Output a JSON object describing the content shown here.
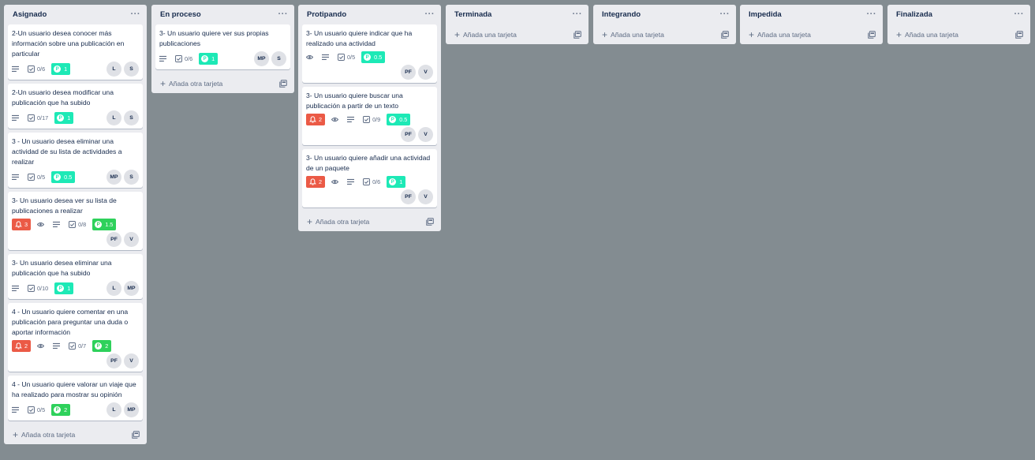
{
  "colors": {
    "board_bg": "#838c91",
    "points_light": "#1de9b6",
    "points_dark": "#2ed15b",
    "alert": "#eb5a46"
  },
  "lists": [
    {
      "title": "Asignado",
      "add_label": "Añada otra tarjeta",
      "cards": [
        {
          "title": "2-Un usuario desea conocer más información sobre una publicación en particular",
          "alert": null,
          "watch": false,
          "desc": true,
          "checklist": "0/6",
          "points": "1",
          "points_style": "light",
          "members": [
            "L",
            "S"
          ]
        },
        {
          "title": "2-Un usuario desea modificar una publicación que ha subido",
          "alert": null,
          "watch": false,
          "desc": true,
          "checklist": "0/17",
          "points": "1",
          "points_style": "light",
          "members": [
            "L",
            "S"
          ]
        },
        {
          "title": "3 - Un usuario desea eliminar una actividad de su lista de actividades a realizar",
          "alert": null,
          "watch": false,
          "desc": true,
          "checklist": "0/5",
          "points": "0.5",
          "points_style": "light",
          "members": [
            "MP",
            "S"
          ]
        },
        {
          "title": "3- Un usuario desea ver su lista de publicaciones a realizar",
          "alert": "3",
          "watch": true,
          "desc": true,
          "checklist": "0/8",
          "points": "1.5",
          "points_style": "dark",
          "members": [
            "PF",
            "V"
          ]
        },
        {
          "title": "3- Un usuario desea eliminar una publicación que ha subido",
          "alert": null,
          "watch": false,
          "desc": true,
          "checklist": "0/10",
          "points": "1",
          "points_style": "light",
          "members": [
            "L",
            "MP"
          ]
        },
        {
          "title": "4 - Un usuario quiere comentar en una publicación para preguntar una duda o aportar información",
          "alert": "2",
          "watch": true,
          "desc": true,
          "checklist": "0/7",
          "points": "2",
          "points_style": "dark",
          "members": [
            "PF",
            "V"
          ]
        },
        {
          "title": "4 - Un usuario quiere valorar un viaje que ha realizado para mostrar su opinión",
          "alert": null,
          "watch": false,
          "desc": true,
          "checklist": "0/5",
          "points": "2",
          "points_style": "dark",
          "members": [
            "L",
            "MP"
          ]
        }
      ]
    },
    {
      "title": "En proceso",
      "add_label": "Añada otra tarjeta",
      "cards": [
        {
          "title": "3- Un usuario quiere ver sus propias publicaciones",
          "alert": null,
          "watch": false,
          "desc": true,
          "checklist": "0/6",
          "points": "1",
          "points_style": "light",
          "members": [
            "MP",
            "S"
          ]
        }
      ]
    },
    {
      "title": "Protipando",
      "add_label": "Añada otra tarjeta",
      "cards": [
        {
          "title": "3- Un usuario quiere indicar que ha realizado una actividad",
          "alert": null,
          "watch": true,
          "desc": true,
          "checklist": "0/5",
          "points": "0.5",
          "points_style": "light",
          "members": [
            "PF",
            "V"
          ]
        },
        {
          "title": "3- Un usuario quiere buscar una publicación a partir de un texto",
          "alert": "2",
          "watch": true,
          "desc": true,
          "checklist": "0/9",
          "points": "0.5",
          "points_style": "light",
          "members": [
            "PF",
            "V"
          ]
        },
        {
          "title": "3- Un usuario quiere añadir una actividad de un paquete",
          "alert": "2",
          "watch": true,
          "desc": true,
          "checklist": "0/6",
          "points": "1",
          "points_style": "light",
          "members": [
            "PF",
            "V"
          ]
        }
      ]
    },
    {
      "title": "Terminada",
      "add_label": "Añada una tarjeta",
      "cards": []
    },
    {
      "title": "Integrando",
      "add_label": "Añada una tarjeta",
      "cards": []
    },
    {
      "title": "Impedida",
      "add_label": "Añada una tarjeta",
      "cards": []
    },
    {
      "title": "Finalizada",
      "add_label": "Añada una tarjeta",
      "cards": []
    }
  ],
  "list_menu_glyph": "···",
  "add_glyph": "+"
}
